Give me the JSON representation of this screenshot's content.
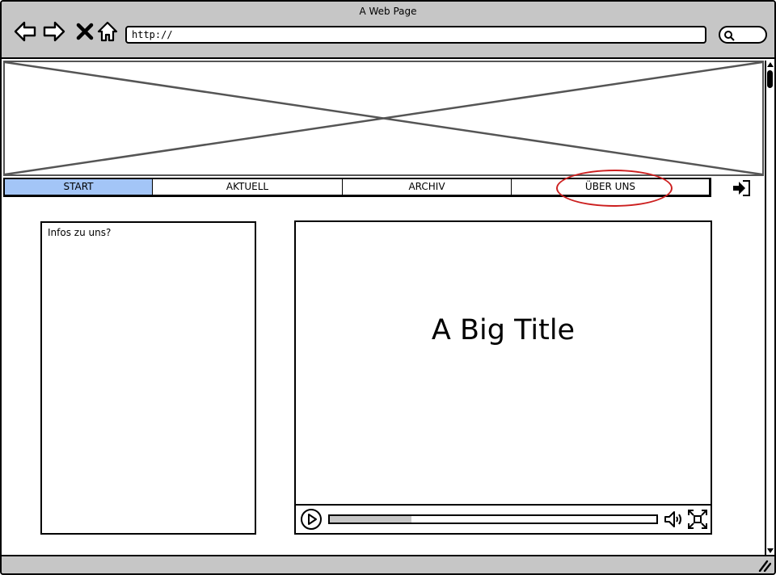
{
  "window": {
    "title": "A Web Page"
  },
  "toolbar": {
    "back_icon": "back-arrow-icon",
    "forward_icon": "forward-arrow-icon",
    "stop_icon": "close-icon",
    "home_icon": "home-icon",
    "search_icon": "search-icon"
  },
  "address_bar": {
    "value": "http://"
  },
  "tabs": [
    {
      "label": "START",
      "active": true
    },
    {
      "label": "AKTUELL",
      "active": false
    },
    {
      "label": "ARCHIV",
      "active": false
    },
    {
      "label": "ÜBER UNS",
      "active": false
    }
  ],
  "login": {
    "icon": "sign-in-icon"
  },
  "info_panel": {
    "text": "Infos zu uns?"
  },
  "video": {
    "title": "A Big Title",
    "progress": 0.25
  },
  "colors": {
    "chrome_bg": "#c6c6c6",
    "active_tab": "#a3c5f7",
    "highlight": "#cc1f1f"
  }
}
